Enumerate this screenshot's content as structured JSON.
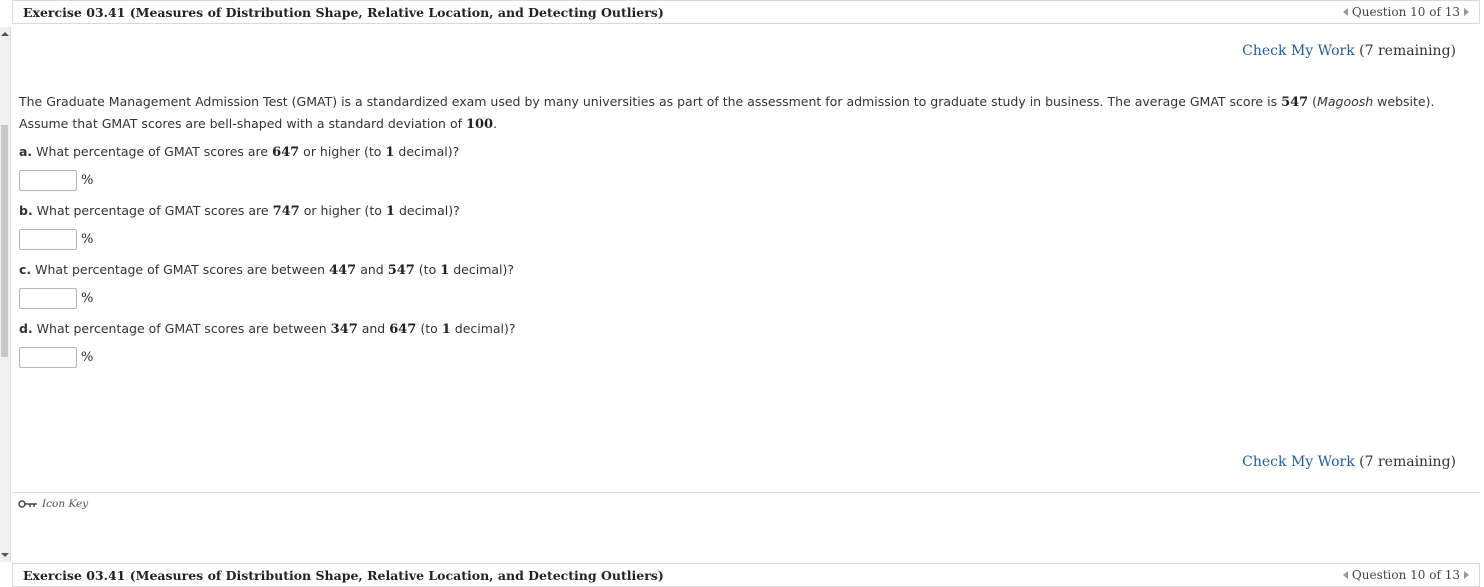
{
  "exercise_title": "Exercise 03.41 (Measures of Distribution Shape, Relative Location, and Detecting Outliers)",
  "question_nav": "Question 10 of 13",
  "check_my_work": {
    "link": "Check My Work",
    "remaining": "(7 remaining)"
  },
  "intro": {
    "part1": "The Graduate Management Admission Test (GMAT) is a standardized exam used by many universities as part of the assessment for admission to graduate study in business. The average GMAT score is ",
    "mean": "547",
    "part2": " (",
    "source": "Magoosh",
    "part3": " website). Assume that GMAT scores are bell-shaped with a standard deviation of ",
    "sd": "100",
    "part4": "."
  },
  "questions": [
    {
      "letter": "a.",
      "pre": " What percentage of GMAT scores are ",
      "v1": "647",
      "mid": " or higher (to ",
      "dec": "1",
      "post": " decimal)?",
      "unit": "%",
      "answer": ""
    },
    {
      "letter": "b.",
      "pre": " What percentage of GMAT scores are ",
      "v1": "747",
      "mid": " or higher (to ",
      "dec": "1",
      "post": " decimal)?",
      "unit": "%",
      "answer": ""
    },
    {
      "letter": "c.",
      "pre": " What percentage of GMAT scores are between ",
      "v1": "447",
      "and": " and ",
      "v2": "547",
      "mid": " (to ",
      "dec": "1",
      "post": " decimal)?",
      "unit": "%",
      "answer": ""
    },
    {
      "letter": "d.",
      "pre": " What percentage of GMAT scores are between ",
      "v1": "347",
      "and": " and ",
      "v2": "647",
      "mid": " (to ",
      "dec": "1",
      "post": " decimal)?",
      "unit": "%",
      "answer": ""
    }
  ],
  "icon_key_label": "Icon Key",
  "icons": {
    "key": "key-icon",
    "prev": "triangle-left-icon",
    "next": "triangle-right-icon"
  }
}
